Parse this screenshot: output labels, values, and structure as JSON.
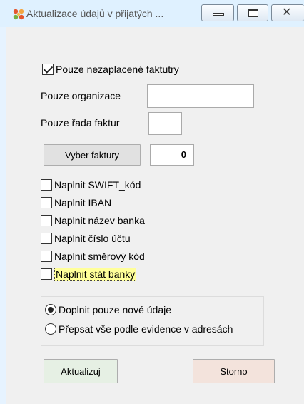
{
  "window": {
    "title": "Aktualizace údajů v přijatých ...",
    "controls": {
      "minimize": "minimize",
      "maximize": "maximize",
      "close": "✕"
    }
  },
  "filters": {
    "unpaid_only": {
      "label": "Pouze nezaplacené faktutry",
      "checked": true
    },
    "organization": {
      "label": "Pouze organizace",
      "value": ""
    },
    "invoice_series": {
      "label": "Pouze řada faktur",
      "value": ""
    }
  },
  "selection": {
    "button_label": "Vyber faktury",
    "count": "0"
  },
  "fill_options": [
    {
      "label": "Naplnit SWIFT_kód",
      "checked": false
    },
    {
      "label": "Naplnit IBAN",
      "checked": false
    },
    {
      "label": "Naplnit název banka",
      "checked": false
    },
    {
      "label": "Naplnit číslo účtu",
      "checked": false
    },
    {
      "label": "Naplnit směrový kód",
      "checked": false
    },
    {
      "label": "Naplnit stát banky",
      "checked": false,
      "focused": true
    }
  ],
  "mode": {
    "options": [
      {
        "label": "Doplnit pouze nové údaje",
        "selected": true
      },
      {
        "label": "Přepsat vše podle evidence v adresách",
        "selected": false
      }
    ]
  },
  "actions": {
    "update_label": "Aktualizuj",
    "cancel_label": "Storno"
  },
  "colors": {
    "titlebar": "#dff1ff",
    "panel": "#f0f0f0",
    "update_button": "#e6f0e4",
    "cancel_button": "#f3e3dc",
    "focus_highlight": "#ffff99"
  }
}
